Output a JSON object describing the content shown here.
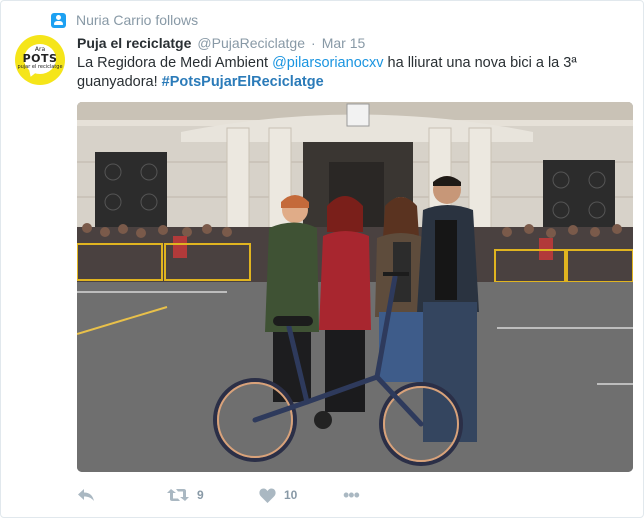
{
  "context": {
    "icon": "follow-icon",
    "text": "Nuria Carrio follows"
  },
  "tweet": {
    "avatar": {
      "line1": "Ara",
      "line2": "POTS",
      "line3": "pujar el reciclatge"
    },
    "author_name": "Puja el reciclatge",
    "author_handle": "@PujaReciclatge",
    "separator": "·",
    "date": "Mar 15",
    "text_part1": "La Regidora de Medi Ambient ",
    "mention": "@pilarsorianocxv",
    "text_part2": " ha lliurat una nova bici a la 3ª guanyadora! ",
    "hashtag": "#PotsPujarElReciclatge",
    "photo_alt": "Four people posing with a folding bicycle in front of a city hall building"
  },
  "actions": {
    "reply_icon": "reply-icon",
    "retweet_icon": "retweet-icon",
    "retweet_count": "9",
    "like_icon": "heart-icon",
    "like_count": "10",
    "more_icon": "more-icon",
    "more_glyph": "•••"
  },
  "colors": {
    "link": "#1b95e0",
    "hashtag": "#2b7bb9",
    "muted": "#8899a6",
    "icon": "#aab8c2",
    "brand_yellow": "#f5e51a"
  }
}
